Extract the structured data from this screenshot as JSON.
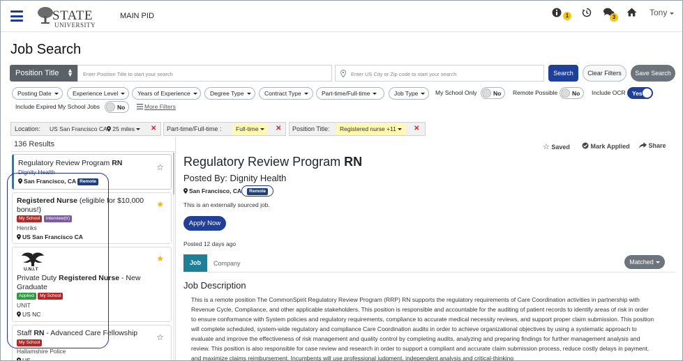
{
  "header": {
    "logo_state": "STATE",
    "logo_university": "UNIVERSITY",
    "nav_title": "MAIN PID",
    "info_badge": "1",
    "messages_badge": "3",
    "user_name": "Tony"
  },
  "page": {
    "title": "Job Search"
  },
  "search": {
    "position_title_label": "Position Title",
    "title_placeholder": "Enter Position Title to start your search",
    "location_placeholder": "Enter US City or Zip code to start your search",
    "search_label": "Search",
    "clear_label": "Clear Filters",
    "save_label": "Save Search"
  },
  "filters": {
    "posting_date": "Posting Date",
    "experience_level": "Experience Level",
    "years_experience": "Years of Experience",
    "degree_type": "Degree Type",
    "contract_type": "Contract Type",
    "part_full_time": "Part-time/Full-time",
    "job_type": "Job Type",
    "my_school_only": {
      "label": "My School Only",
      "value": "No"
    },
    "remote_possible": {
      "label": "Remote Possible",
      "value": "No"
    },
    "include_ocr": {
      "label": "Include OCR",
      "value": "Yes"
    },
    "include_expired": {
      "label": "Include Expired My School Jobs",
      "value": "No"
    },
    "more_filters": "More Filters"
  },
  "active_filters": {
    "location_label": "Location:",
    "location_value": "US San Francisco CA",
    "radius": "25 miles",
    "part_full_label": "Part-time/Full-time :",
    "part_full_value": "Full-time",
    "position_label": "Position Title:",
    "position_value": "Registered nurse +11"
  },
  "results": {
    "count": "136 Results",
    "cards": [
      {
        "title_plain": "Regulatory Review Program ",
        "title_bold": "RN",
        "company": "Dignity Health",
        "location": "San Francisco, CA",
        "tag": "Remote"
      },
      {
        "title_bold": "Registered Nurse",
        "title_plain": " (eligible for $10,000 bonus!)",
        "tag1": "My School",
        "tag2": "Interview(tr)",
        "company": "Henriks",
        "location": "US San Francisco CA"
      },
      {
        "logo_text": "U.N.I.T",
        "title_plain_pre": "Private Duty ",
        "title_bold": "Registered Nurse",
        "title_plain_post": " - New Graduate",
        "tag1": "Applied",
        "tag2": "My School",
        "company": "UNIT",
        "location": "US NC"
      },
      {
        "title_plain_pre": "Staff ",
        "title_bold": "RN",
        "title_plain_post": " - Advanced Care Fellowship",
        "tag1": "My School",
        "company": "Hallamshire Police",
        "location": "US"
      }
    ]
  },
  "detail": {
    "saved": "Saved",
    "mark_applied": "Mark Applied",
    "share": "Share",
    "title_plain": "Regulatory Review Program ",
    "title_bold": "RN",
    "posted_by": "Posted By: Dignity Health",
    "location": "San Francisco, CA",
    "remote_tag": "Remote",
    "external_note": "This is an externally sourced job.",
    "apply_label": "Apply Now",
    "posted_ago": "Posted 12 days ago",
    "tab_job": "Job",
    "tab_company": "Company",
    "matched_label": "Matched",
    "description_title": "Job Description",
    "description_body": "This is a remote position The CommonSpirit Regulatory Review Program (RRP) RN supports the regulatory requirements of Care Coordination activities in partnership with Revenue Cycle, Compliance, and other applicable stakeholders. This position is responsible and accountable for the auditing of patient records to identify areas of risk in order to ensure conformance with System policies and regulatory requirements, compliance to accurate medical necessity reviews, and support proper claim submission. This position will complete scheduled, system-wide regulatory and compliance Care Coordination audits in order to achieve organizational objectives by using a systematic approach to evaluate and improve the effectiveness of risk management and quality control by completing audits, analyzing and preparing findings for further management analysis and review. This position is also responsible for case review and research in order to support a compliant and accurate claim submission process, reduce costly delays in payment, and maximize claims reimbursement. Incumbents will use professional judgment, independent analysis and critical-thinking"
  }
}
